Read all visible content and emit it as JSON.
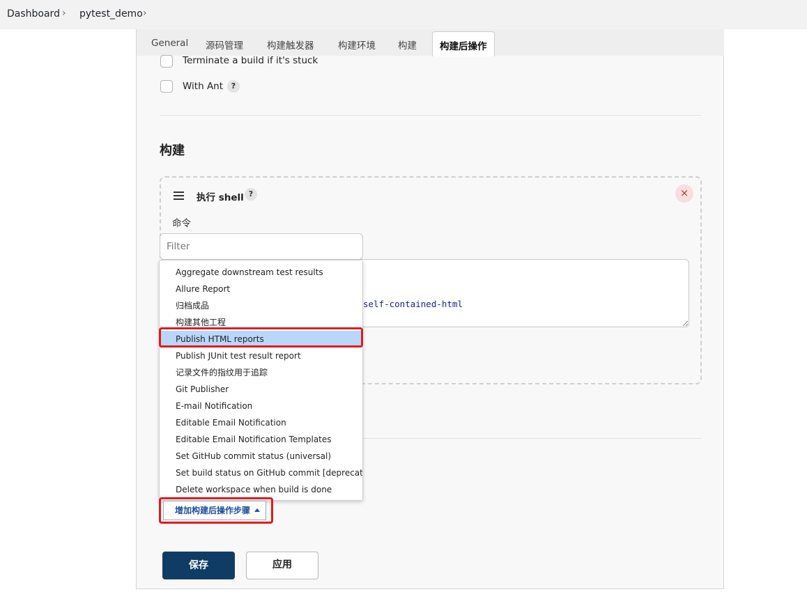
{
  "breadcrumb": {
    "items": [
      "Dashboard",
      "pytest_demo"
    ]
  },
  "tabs": [
    {
      "label": "General",
      "active": false
    },
    {
      "label": "源码管理",
      "active": false
    },
    {
      "label": "构建触发器",
      "active": false
    },
    {
      "label": "构建环境",
      "active": false
    },
    {
      "label": "构建",
      "active": false
    },
    {
      "label": "构建后操作",
      "active": true
    }
  ],
  "env_options": [
    {
      "label": "Terminate a build if it's stuck",
      "checked": false
    },
    {
      "label": "With Ant",
      "checked": false,
      "help": "?"
    }
  ],
  "build_section": {
    "title": "构建",
    "step": {
      "title": "执行 shell",
      "help": "?",
      "close_icon": "×",
      "command_label": "命令",
      "command_visible_text": "self-contained-html"
    }
  },
  "filter": {
    "placeholder": "Filter",
    "value": ""
  },
  "dropdown": {
    "items": [
      "Aggregate downstream test results",
      "Allure Report",
      "归档成品",
      "构建其他工程",
      "Publish HTML reports",
      "Publish JUnit test result report",
      "记录文件的指纹用于追踪",
      "Git Publisher",
      "E-mail Notification",
      "Editable Email Notification",
      "Editable Email Notification Templates",
      "Set GitHub commit status (universal)",
      "Set build status on GitHub commit [deprecated]",
      "Delete workspace when build is done"
    ],
    "selected": "Publish HTML reports"
  },
  "add_post_build": {
    "label": "增加构建后操作步骤"
  },
  "actions": {
    "save": "保存",
    "apply": "应用"
  },
  "colors": {
    "save_bg": "#0f3c64",
    "highlight_red": "#e11b1b",
    "selected_item_bg": "#b8d7fb"
  },
  "icons": {
    "breadcrumb_separator": "chevron-right-icon",
    "drag_handle": "hamburger-icon",
    "close": "close-icon",
    "dropdown_caret": "caret-up-icon"
  }
}
